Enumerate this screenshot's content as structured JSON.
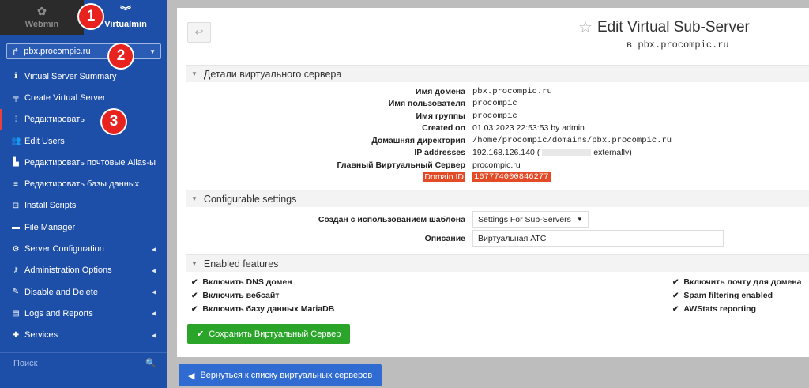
{
  "topbar": {
    "webmin_label": "Webmin",
    "virtualmin_label": "Virtualmin"
  },
  "domain_select": {
    "value": "pbx.procompic.ru"
  },
  "sidebar": {
    "items": [
      {
        "label": "Virtual Server Summary",
        "icon": "info-icon",
        "glyph": "ℹ",
        "submenu": false
      },
      {
        "label": "Create Virtual Server",
        "icon": "create-server-icon",
        "glyph": "╤",
        "submenu": false
      },
      {
        "label": "Редактировать",
        "icon": "sliders-icon",
        "glyph": "⫶",
        "submenu": false,
        "active": true
      },
      {
        "label": "Edit Users",
        "icon": "users-icon",
        "glyph": "👥",
        "submenu": false
      },
      {
        "label": "Редактировать почтовые Alias-ы",
        "icon": "mail-alias-icon",
        "glyph": "▙",
        "submenu": false
      },
      {
        "label": "Редактировать базы данных",
        "icon": "database-icon",
        "glyph": "≡",
        "submenu": false
      },
      {
        "label": "Install Scripts",
        "icon": "download-icon",
        "glyph": "⊡",
        "submenu": false
      },
      {
        "label": "File Manager",
        "icon": "folder-icon",
        "glyph": "▬",
        "submenu": false
      },
      {
        "label": "Server Configuration",
        "icon": "gears-icon",
        "glyph": "⚙",
        "submenu": true
      },
      {
        "label": "Administration Options",
        "icon": "key-icon",
        "glyph": "⚷",
        "submenu": true
      },
      {
        "label": "Disable and Delete",
        "icon": "plug-icon",
        "glyph": "✎",
        "submenu": true
      },
      {
        "label": "Logs and Reports",
        "icon": "logs-icon",
        "glyph": "▤",
        "submenu": true
      },
      {
        "label": "Services",
        "icon": "puzzle-icon",
        "glyph": "✚",
        "submenu": true
      }
    ],
    "search_placeholder": "Поиск"
  },
  "badges": [
    "1",
    "2",
    "3"
  ],
  "header": {
    "title": "Edit Virtual Sub-Server",
    "subtitle_prefix": "в",
    "subtitle_domain": "pbx.procompic.ru"
  },
  "details": {
    "heading": "Детали виртуального сервера",
    "rows": [
      {
        "key": "Имя домена",
        "value": "pbx.procompic.ru"
      },
      {
        "key": "Имя пользователя",
        "value": "procompic"
      },
      {
        "key": "Имя группы",
        "value": "procompic"
      },
      {
        "key": "Created on",
        "value": "01.03.2023 22:53:53 by admin"
      },
      {
        "key": "Домашняя директория",
        "value": "/home/procompic/domains/pbx.procompic.ru"
      },
      {
        "key": "IP addresses",
        "value_prefix": "192.168.126.140 (",
        "value_suffix": "externally)"
      },
      {
        "key": "Главный Виртуальный Сервер",
        "value": "procompic.ru"
      },
      {
        "key": "Domain ID",
        "value": "167774000846277"
      }
    ]
  },
  "configurable": {
    "heading": "Configurable settings",
    "template_label": "Создан с использованием шаблона",
    "template_value": "Settings For Sub-Servers",
    "description_label": "Описание",
    "description_value": "Виртуальная АТС"
  },
  "features": {
    "heading": "Enabled features",
    "left": [
      "Включить DNS домен",
      "Включить вебсайт",
      "Включить базу данных MariaDB"
    ],
    "right": [
      "Включить почту для домена",
      "Spam filtering enabled",
      "AWStats reporting"
    ]
  },
  "save_button": "Сохранить Виртуальный Сервер",
  "return_button": "Вернуться к списку виртуальных серверов",
  "colors": {
    "sidebar": "#1e4fa8",
    "badge": "#e8231f",
    "save": "#2aa52a",
    "return": "#2f6bd1",
    "highlight": "#e24b26"
  }
}
